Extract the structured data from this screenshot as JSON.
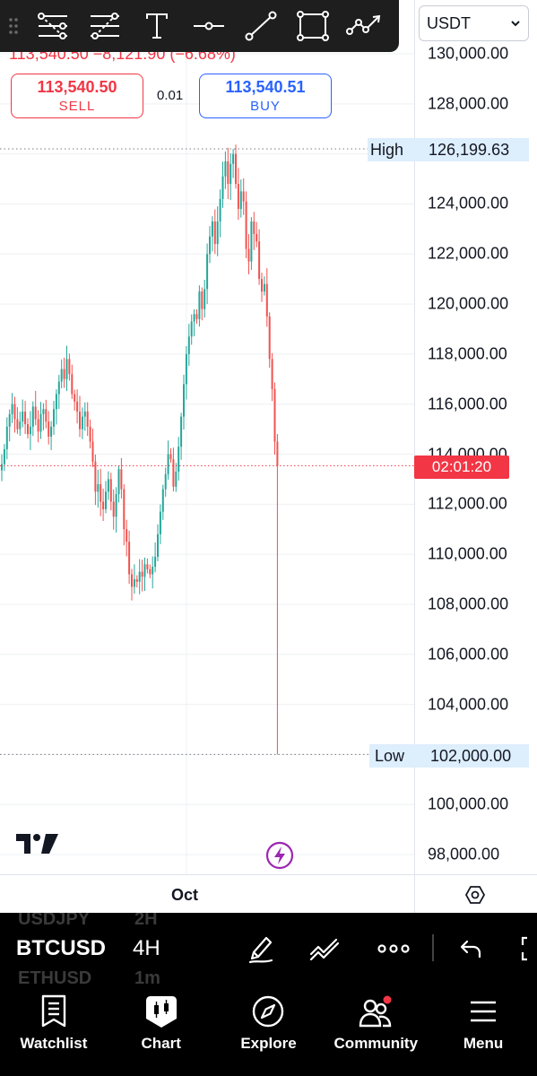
{
  "toolbar": {
    "tools": [
      "pitchfork-icon",
      "fib-retracement-icon",
      "text-icon",
      "horizontal-line-icon",
      "trend-line-icon",
      "rectangle-icon",
      "path-icon"
    ]
  },
  "currency": {
    "selected": "USDT"
  },
  "ticker_line": "113,540.50  −8,121.90 (−6.68%)",
  "trade": {
    "sell_price": "113,540.50",
    "sell_label": "SELL",
    "spread": "0.01",
    "buy_price": "113,540.51",
    "buy_label": "BUY"
  },
  "price_axis": {
    "labels": [
      "130,000.00",
      "128,000.00",
      "124,000.00",
      "122,000.00",
      "120,000.00",
      "118,000.00",
      "116,000.00",
      "114,000.00",
      "112,000.00",
      "110,000.00",
      "108,000.00",
      "106,000.00",
      "104,000.00",
      "100,000.00",
      "98,000.00"
    ],
    "high_label": "High",
    "high_value": "126,199.63",
    "low_label": "Low",
    "low_value": "102,000.00",
    "countdown": "02:01:20"
  },
  "time_axis": {
    "label": "Oct"
  },
  "symbols": {
    "above_symbol": "USDJPY",
    "above_tf": "2H",
    "current_symbol": "BTCUSD",
    "current_tf": "4H",
    "below_symbol": "ETHUSD",
    "below_tf": "1m"
  },
  "nav": [
    {
      "label": "Watchlist",
      "icon": "watchlist-icon"
    },
    {
      "label": "Chart",
      "icon": "chart-icon"
    },
    {
      "label": "Explore",
      "icon": "compass-icon"
    },
    {
      "label": "Community",
      "icon": "community-icon"
    },
    {
      "label": "Menu",
      "icon": "menu-icon"
    }
  ],
  "colors": {
    "up": "#26a69a",
    "down": "#ef5350",
    "sell": "#f23645",
    "buy": "#2962ff",
    "axis_highlight": "#ddeefd"
  },
  "chart_data": {
    "type": "candlestick",
    "symbol": "BTCUSD",
    "timeframe": "4H",
    "currency": "USDT",
    "ylim": [
      97000,
      131000
    ],
    "yticks": [
      98000,
      100000,
      102000,
      104000,
      106000,
      108000,
      110000,
      112000,
      114000,
      116000,
      118000,
      120000,
      122000,
      124000,
      126000,
      128000,
      130000
    ],
    "x_labels": [
      "Oct"
    ],
    "high": 126199.63,
    "low": 102000.0,
    "last_price": 113540.5,
    "change": -8121.9,
    "change_percent": -6.68,
    "closes": [
      113600,
      114200,
      115100,
      115600,
      116000,
      115400,
      115000,
      115300,
      115700,
      115200,
      114800,
      115100,
      115900,
      115400,
      114900,
      115600,
      115800,
      115300,
      114700,
      115100,
      115800,
      116400,
      116900,
      117400,
      117000,
      117800,
      117200,
      116400,
      116100,
      115700,
      115000,
      115500,
      115700,
      115100,
      114500,
      113700,
      112500,
      112800,
      112100,
      111800,
      112500,
      113000,
      112100,
      111500,
      112400,
      113400,
      112600,
      111000,
      110500,
      109200,
      108700,
      109000,
      108900,
      109300,
      109100,
      109600,
      109400,
      109200,
      109500,
      109900,
      110800,
      111700,
      112600,
      113200,
      114000,
      113800,
      112700,
      113300,
      114300,
      115500,
      116800,
      118000,
      118700,
      119300,
      119600,
      119400,
      120500,
      119800,
      120600,
      122000,
      122700,
      123300,
      122400,
      123300,
      124200,
      125100,
      125700,
      124800,
      125600,
      126000,
      124800,
      123800,
      124500,
      124100,
      122200,
      121700,
      123300,
      122800,
      122500,
      121000,
      120500,
      120800,
      119500,
      117800,
      116600,
      114500,
      113540
    ]
  }
}
